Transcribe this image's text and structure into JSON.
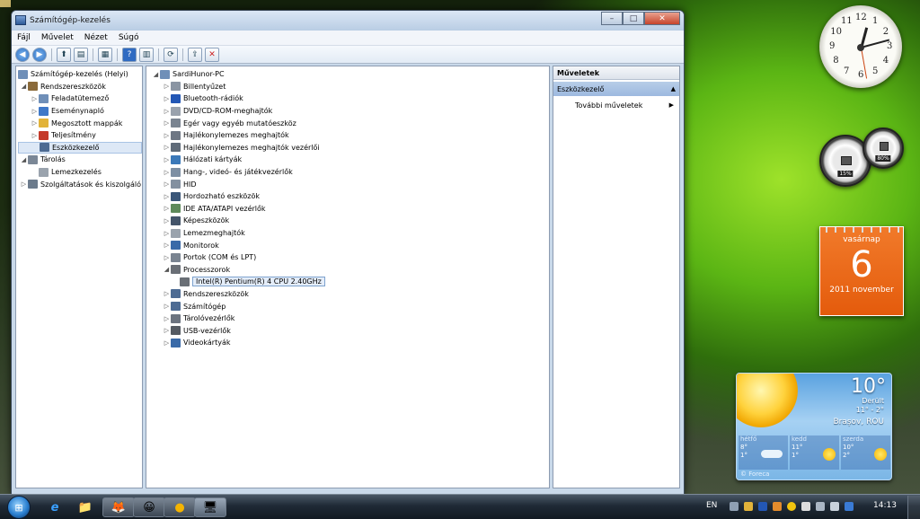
{
  "window": {
    "title": "Számítógép-kezelés",
    "controls": {
      "minimize": "–",
      "maximize": "□",
      "close": "✕"
    }
  },
  "menu": [
    "Fájl",
    "Művelet",
    "Nézet",
    "Súgó"
  ],
  "toolbar": [
    "back-icon",
    "forward-icon",
    "up-folder-icon",
    "console-tree-icon",
    "properties-icon",
    "export-icon",
    "help-icon",
    "show-hide-icon",
    "scan-hardware-icon",
    "update-driver-icon",
    "disable-device-icon"
  ],
  "tree": {
    "root": "Számítógép-kezelés (Helyi)",
    "items": [
      {
        "label": "Rendszereszközök",
        "level": 1,
        "exp": "◢",
        "icon": "#8a6a3a"
      },
      {
        "label": "Feladatütemező",
        "level": 2,
        "exp": "▷",
        "icon": "#6f8fb8"
      },
      {
        "label": "Eseménynapló",
        "level": 2,
        "exp": "▷",
        "icon": "#3f78c8"
      },
      {
        "label": "Megosztott mappák",
        "level": 2,
        "exp": "▷",
        "icon": "#e2b33a"
      },
      {
        "label": "Teljesítmény",
        "level": 2,
        "exp": "▷",
        "icon": "#c43a2a"
      },
      {
        "label": "Eszközkezelő",
        "level": 2,
        "exp": "",
        "icon": "#4d6b93",
        "selected": true
      },
      {
        "label": "Tárolás",
        "level": 1,
        "exp": "◢",
        "icon": "#7b8796"
      },
      {
        "label": "Lemezkezelés",
        "level": 2,
        "exp": "",
        "icon": "#9aa3ad"
      },
      {
        "label": "Szolgáltatások és kiszolgáló",
        "level": 1,
        "exp": "▷",
        "icon": "#6c7b8c"
      }
    ]
  },
  "devices": {
    "root": "SardiHunor-PC",
    "items": [
      {
        "label": "Billentyűzet",
        "exp": "▷",
        "icon": "#8a95a3"
      },
      {
        "label": "Bluetooth-rádiók",
        "exp": "▷",
        "icon": "#2357b5"
      },
      {
        "label": "DVD/CD-ROM-meghajtók",
        "exp": "▷",
        "icon": "#9aa2ad"
      },
      {
        "label": "Egér vagy egyéb mutatóeszköz",
        "exp": "▷",
        "icon": "#7a8491"
      },
      {
        "label": "Hajlékonylemezes meghajtók",
        "exp": "▷",
        "icon": "#6e7784"
      },
      {
        "label": "Hajlékonylemezes meghajtók vezérlői",
        "exp": "▷",
        "icon": "#5f6b79"
      },
      {
        "label": "Hálózati kártyák",
        "exp": "▷",
        "icon": "#3b79b9"
      },
      {
        "label": "Hang-, videó- és játékvezérlők",
        "exp": "▷",
        "icon": "#7d8fa3"
      },
      {
        "label": "HID",
        "exp": "▷",
        "icon": "#8390a0"
      },
      {
        "label": "Hordozható eszközök",
        "exp": "▷",
        "icon": "#3a5678"
      },
      {
        "label": "IDE ATA/ATAPI vezérlők",
        "exp": "▷",
        "icon": "#5e8a5a"
      },
      {
        "label": "Képeszközök",
        "exp": "▷",
        "icon": "#44556a"
      },
      {
        "label": "Lemezmeghajtók",
        "exp": "▷",
        "icon": "#9aa3ad"
      },
      {
        "label": "Monitorok",
        "exp": "▷",
        "icon": "#3a6aa8"
      },
      {
        "label": "Portok (COM és LPT)",
        "exp": "▷",
        "icon": "#7a8491"
      },
      {
        "label": "Processzorok",
        "exp": "◢",
        "icon": "#6a6f76"
      },
      {
        "label": "Intel(R) Pentium(R) 4 CPU 2.40GHz",
        "exp": "",
        "icon": "#6a6f76",
        "child": true,
        "selected": true
      },
      {
        "label": "Rendszereszközök",
        "exp": "▷",
        "icon": "#4d6b93"
      },
      {
        "label": "Számítógép",
        "exp": "▷",
        "icon": "#4d6b93"
      },
      {
        "label": "Tárolóvezérlők",
        "exp": "▷",
        "icon": "#6c7480"
      },
      {
        "label": "USB-vezérlők",
        "exp": "▷",
        "icon": "#555b63"
      },
      {
        "label": "Videokártyák",
        "exp": "▷",
        "icon": "#3a6aa8"
      }
    ]
  },
  "actions": {
    "header": "Műveletek",
    "section": "Eszközkezelő",
    "section_arrow": "▲",
    "more": "További műveletek",
    "more_arrow": "▶"
  },
  "clock": {
    "numerals": [
      "12",
      "1",
      "2",
      "3",
      "4",
      "5",
      "6",
      "7",
      "8",
      "9",
      "10",
      "11"
    ]
  },
  "meter": {
    "cpu": "15%",
    "ram": "80%"
  },
  "calendar": {
    "weekday": "vasárnap",
    "day": "6",
    "month_year": "2011 november"
  },
  "weather": {
    "temp": "10°",
    "condition": "Derült",
    "range": "11° - 2°",
    "location": "Brașov, ROU",
    "forecast": [
      {
        "day": "hétfő",
        "high": "8°",
        "low": "1°",
        "icon": "cloud-icon"
      },
      {
        "day": "kedd",
        "high": "11°",
        "low": "1°",
        "icon": "sun-icon"
      },
      {
        "day": "szerda",
        "high": "10°",
        "low": "2°",
        "icon": "sun-icon"
      }
    ],
    "brand": "© Foreca"
  },
  "taskbar": {
    "start": "⊞",
    "pinned": [
      "e",
      "📁",
      "🦊",
      "😀",
      "●",
      "🖥"
    ],
    "lang": "EN",
    "time": "14:13"
  }
}
